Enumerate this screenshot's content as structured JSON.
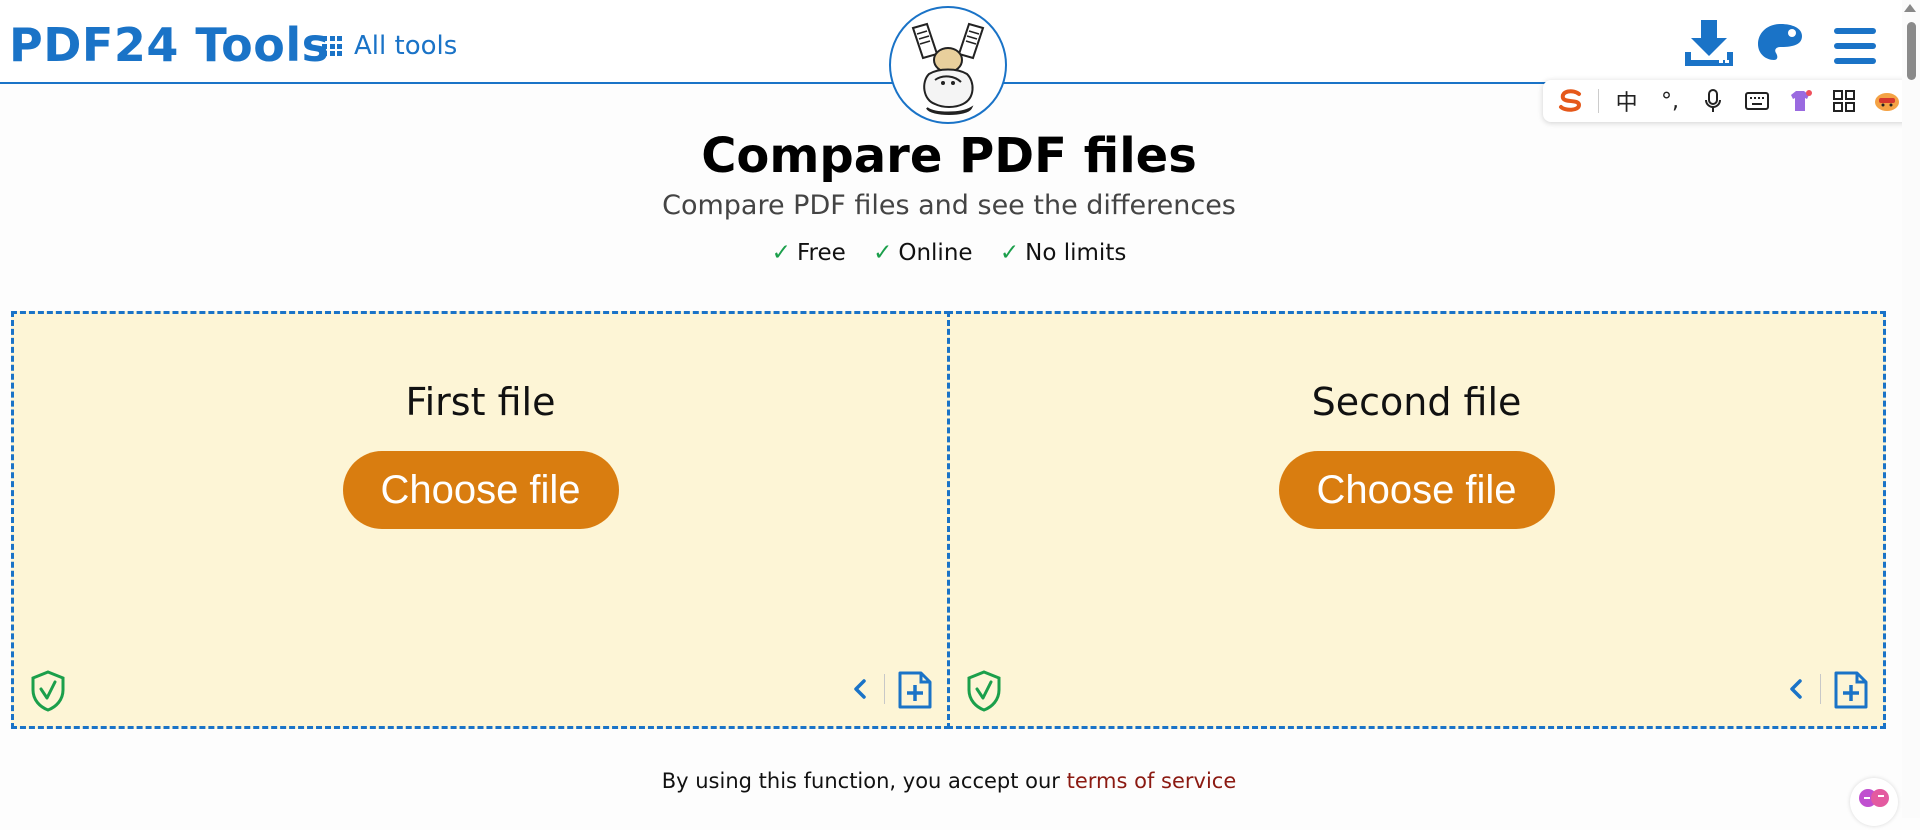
{
  "header": {
    "logo": "PDF24 Tools",
    "all_tools_label": "All tools"
  },
  "icons": {
    "download": "download-icon",
    "palette": "palette-icon",
    "menu": "hamburger-menu-icon",
    "grid": "grid-icon",
    "shield": "shield-check-icon",
    "chevron": "chevron-left-icon",
    "add_file": "add-file-icon"
  },
  "ime_toolbar": {
    "items": [
      "S",
      "中",
      "°,",
      "mic",
      "keyboard",
      "skin",
      "apps",
      "face"
    ]
  },
  "main": {
    "title": "Compare PDF files",
    "subtitle": "Compare PDF files and see the differences",
    "features": [
      "Free",
      "Online",
      "No limits"
    ],
    "check": "✓"
  },
  "zones": [
    {
      "label": "First file",
      "button": "Choose file"
    },
    {
      "label": "Second file",
      "button": "Choose file"
    }
  ],
  "footer": {
    "tos_prefix": "By using this function, you accept our ",
    "tos_link": "terms of service"
  },
  "colors": {
    "brand_blue": "#1a73c7",
    "button_orange": "#d97d10",
    "zone_bg": "#fdf5d6",
    "check_green": "#1b9f4b",
    "tos_link": "#8b1a12"
  }
}
